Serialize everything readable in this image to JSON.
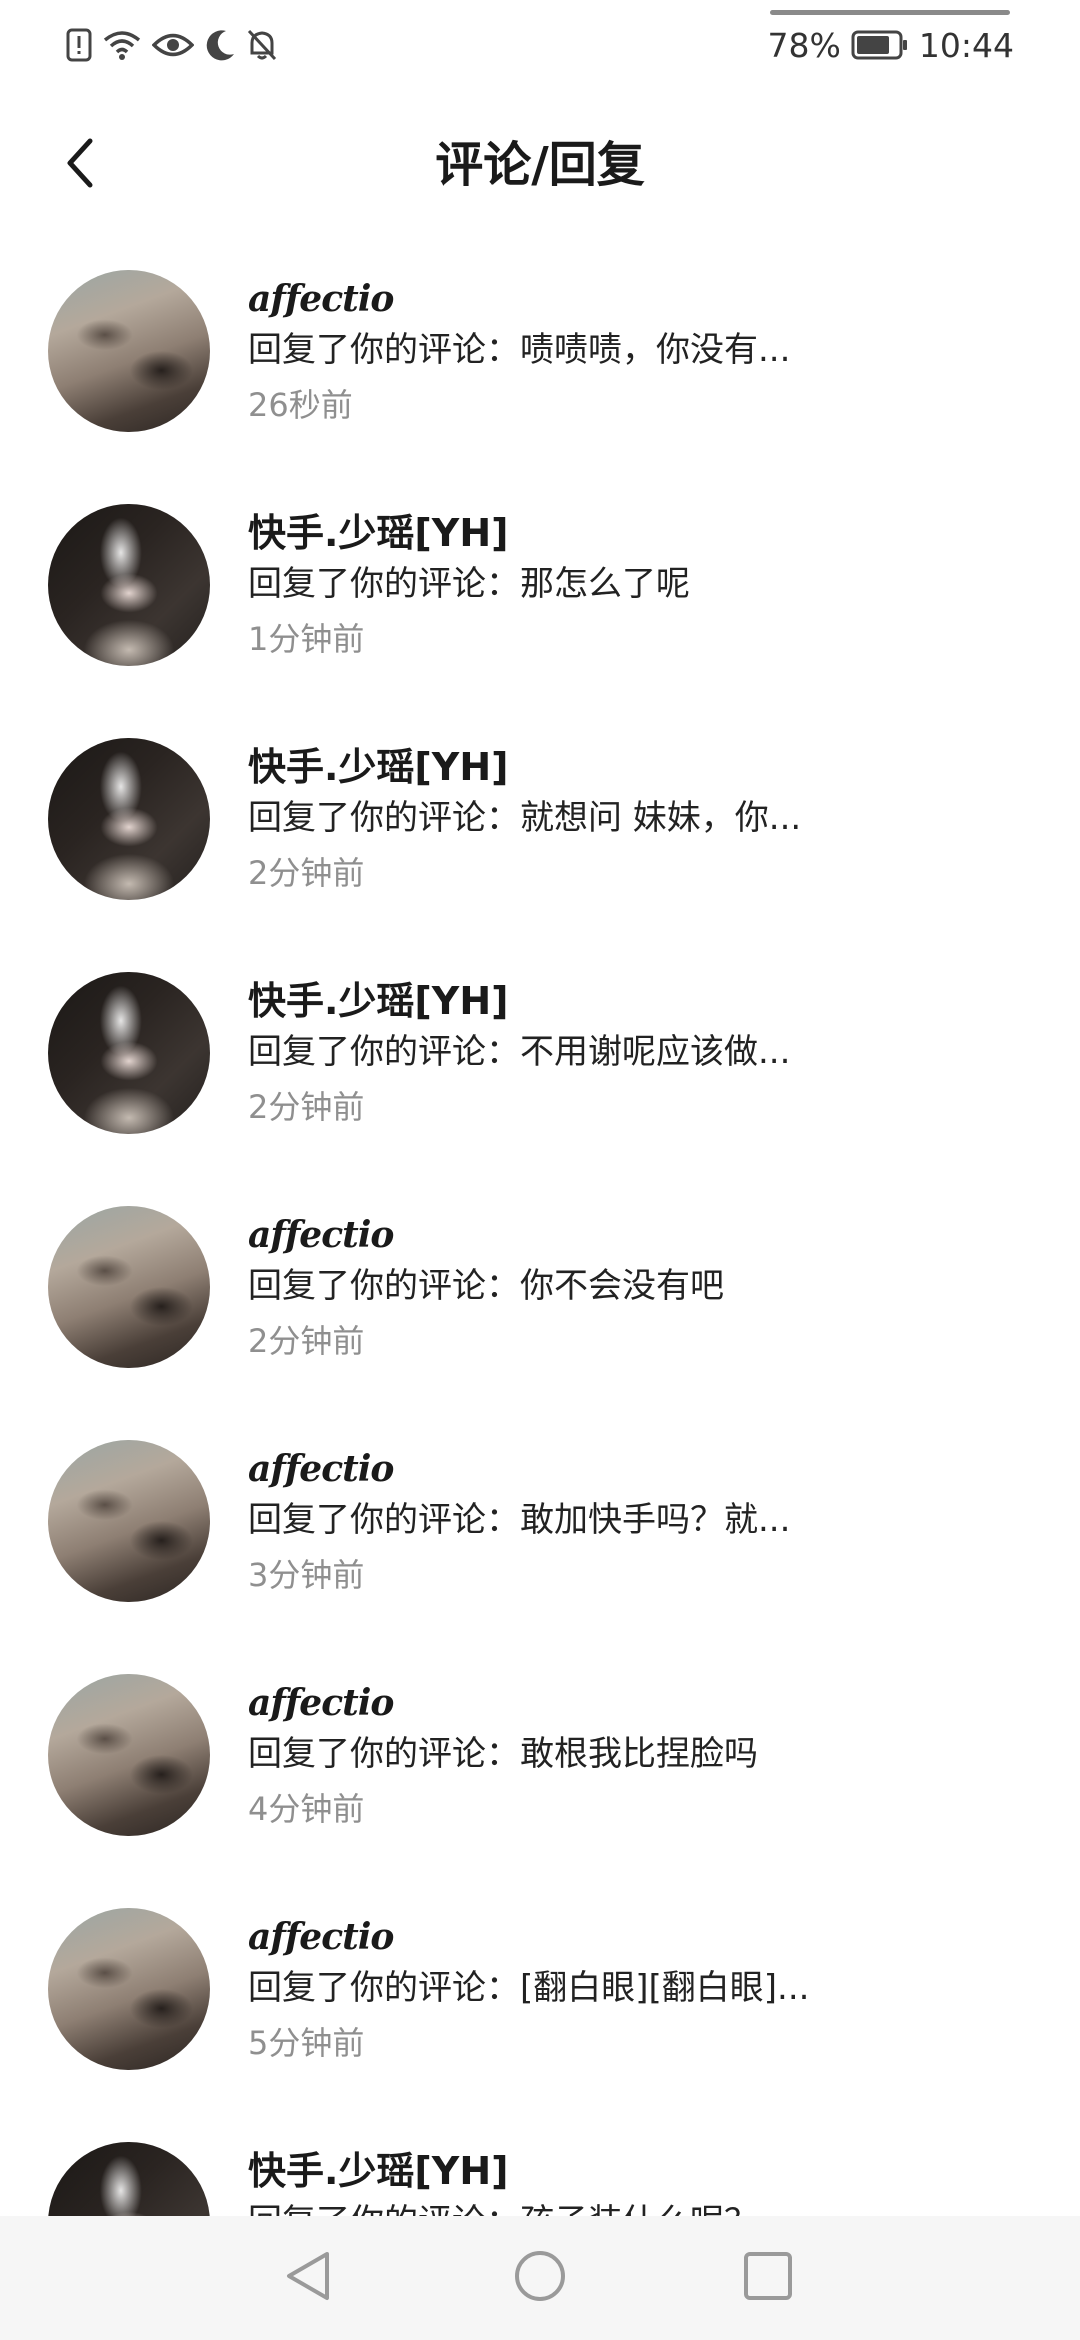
{
  "status_bar": {
    "battery": "78%",
    "time": "10:44",
    "icons": [
      "alert-icon",
      "wifi-icon",
      "eye-icon",
      "moon-icon",
      "bell-off-icon",
      "battery-icon"
    ]
  },
  "header": {
    "title": "评论/回复",
    "back_icon": "chevron-left-icon"
  },
  "notifications": [
    {
      "name": "affectio",
      "comment": "回复了你的评论：啧啧啧，你没有...",
      "time": "26秒前",
      "avatar": "a"
    },
    {
      "name": "快手.少瑶[YH]",
      "comment": "回复了你的评论：那怎么了呢",
      "time": "1分钟前",
      "avatar": "b"
    },
    {
      "name": "快手.少瑶[YH]",
      "comment": "回复了你的评论：就想问 妹妹，你...",
      "time": "2分钟前",
      "avatar": "b"
    },
    {
      "name": "快手.少瑶[YH]",
      "comment": "回复了你的评论：不用谢呢应该做...",
      "time": "2分钟前",
      "avatar": "b"
    },
    {
      "name": "affectio",
      "comment": "回复了你的评论：你不会没有吧",
      "time": "2分钟前",
      "avatar": "a"
    },
    {
      "name": "affectio",
      "comment": "回复了你的评论：敢加快手吗？就...",
      "time": "3分钟前",
      "avatar": "a"
    },
    {
      "name": "affectio",
      "comment": "回复了你的评论：敢根我比捏脸吗",
      "time": "4分钟前",
      "avatar": "a"
    },
    {
      "name": "affectio",
      "comment": "回复了你的评论：[翻白眼][翻白眼]...",
      "time": "5分钟前",
      "avatar": "a"
    },
    {
      "name": "快手.少瑶[YH]",
      "comment": "回复了你的评论：孩子装什么呢？",
      "time": "",
      "avatar": "b"
    }
  ],
  "nav_bar": {
    "icons": [
      "nav-back-icon",
      "nav-home-icon",
      "nav-recents-icon"
    ]
  },
  "colors": {
    "background": "#ffffff",
    "text_primary": "#1a1a1a",
    "text_secondary": "#8f8f8f",
    "nav_background": "#f6f6f6"
  }
}
